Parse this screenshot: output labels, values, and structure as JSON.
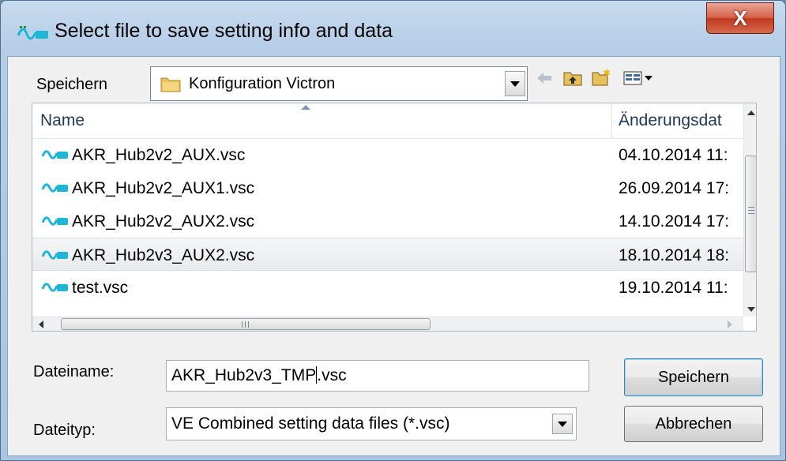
{
  "window": {
    "title": "Select file to save setting info and data",
    "close_label": "X"
  },
  "location": {
    "label": "Speichern",
    "current_folder": "Konfiguration Victron"
  },
  "file_list": {
    "columns": [
      "Name",
      "Änderungsdat"
    ],
    "files": [
      {
        "name": "AKR_Hub2v2_AUX.vsc",
        "modified": "04.10.2014 11:",
        "selected": false
      },
      {
        "name": "AKR_Hub2v2_AUX1.vsc",
        "modified": "26.09.2014 17:",
        "selected": false
      },
      {
        "name": "AKR_Hub2v2_AUX2.vsc",
        "modified": "14.10.2014 17:",
        "selected": false
      },
      {
        "name": "AKR_Hub2v3_AUX2.vsc",
        "modified": "18.10.2014 18:",
        "selected": true
      },
      {
        "name": "test.vsc",
        "modified": "19.10.2014 11:",
        "selected": false
      }
    ]
  },
  "filename": {
    "label": "Dateiname:",
    "value_before_cursor": "AKR_Hub2v3_TMP",
    "value_after_cursor": ".vsc"
  },
  "filetype": {
    "label": "Dateityp:",
    "value": "VE Combined setting data files (*.vsc)"
  },
  "buttons": {
    "save": "Speichern",
    "cancel": "Abbrechen"
  },
  "icons": {
    "app": "victron-app-icon",
    "folder": "folder-icon",
    "back": "back-arrow-icon",
    "up": "up-folder-icon",
    "new_folder": "new-folder-icon",
    "view": "view-menu-icon",
    "file": "vsc-file-icon"
  },
  "colors": {
    "close_button": "#c7432a",
    "file_icon": "#1fb5d6",
    "selection": "#e8eaec"
  }
}
